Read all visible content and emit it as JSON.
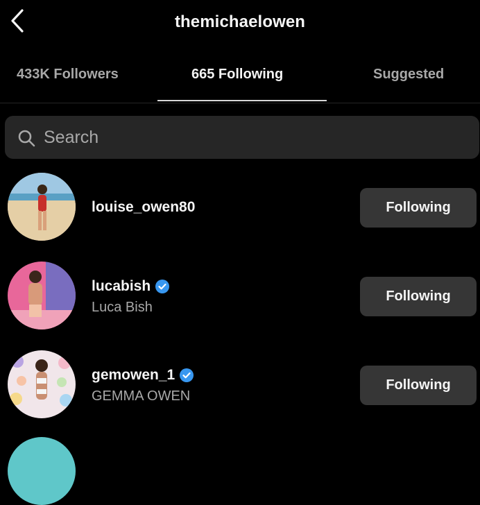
{
  "header": {
    "title": "themichaelowen",
    "back_icon": "chevron-left-icon"
  },
  "tabs": [
    {
      "label": "433K Followers",
      "active": false
    },
    {
      "label": "665 Following",
      "active": true
    },
    {
      "label": "Suggested",
      "active": false
    }
  ],
  "search": {
    "placeholder": "Search",
    "value": "",
    "icon": "search-icon"
  },
  "users": [
    {
      "username": "louise_owen80",
      "full_name": "",
      "verified": false,
      "button_label": "Following"
    },
    {
      "username": "lucabish",
      "full_name": "Luca Bish",
      "verified": true,
      "button_label": "Following"
    },
    {
      "username": "gemowen_1",
      "full_name": "GEMMA OWEN",
      "verified": true,
      "button_label": "Following"
    }
  ],
  "colors": {
    "background": "#000000",
    "search_bg": "#262626",
    "button_bg": "#363636",
    "verified": "#3897f0",
    "secondary_text": "#a8a8a8"
  }
}
